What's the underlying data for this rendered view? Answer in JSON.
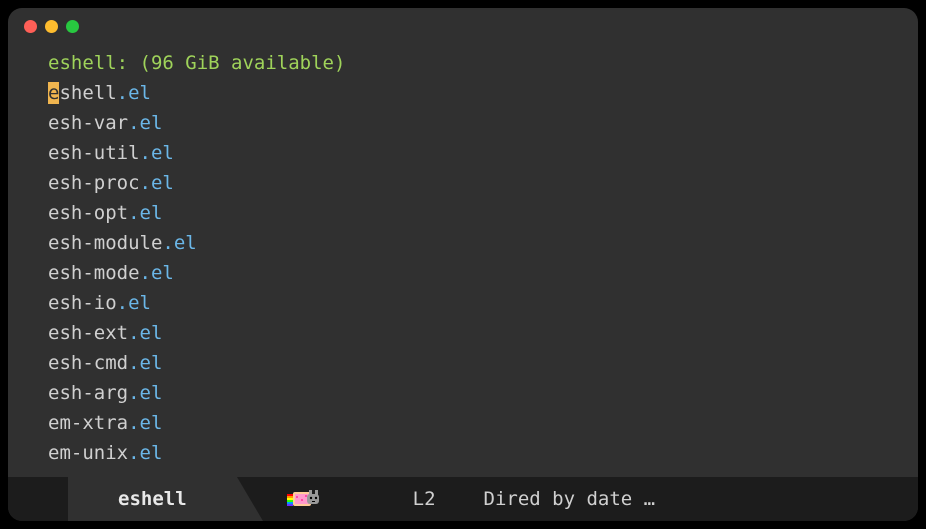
{
  "header": "eshell: (96 GiB available)",
  "files": [
    {
      "base": "eshell",
      "ext": ".el",
      "cursor": true
    },
    {
      "base": "esh-var",
      "ext": ".el"
    },
    {
      "base": "esh-util",
      "ext": ".el"
    },
    {
      "base": "esh-proc",
      "ext": ".el"
    },
    {
      "base": "esh-opt",
      "ext": ".el"
    },
    {
      "base": "esh-module",
      "ext": ".el"
    },
    {
      "base": "esh-mode",
      "ext": ".el"
    },
    {
      "base": "esh-io",
      "ext": ".el"
    },
    {
      "base": "esh-ext",
      "ext": ".el"
    },
    {
      "base": "esh-cmd",
      "ext": ".el"
    },
    {
      "base": "esh-arg",
      "ext": ".el"
    },
    {
      "base": "em-xtra",
      "ext": ".el"
    },
    {
      "base": "em-unix",
      "ext": ".el"
    }
  ],
  "modeline": {
    "buffer": "eshell",
    "line": "L2",
    "mode": "Dired by date …"
  }
}
